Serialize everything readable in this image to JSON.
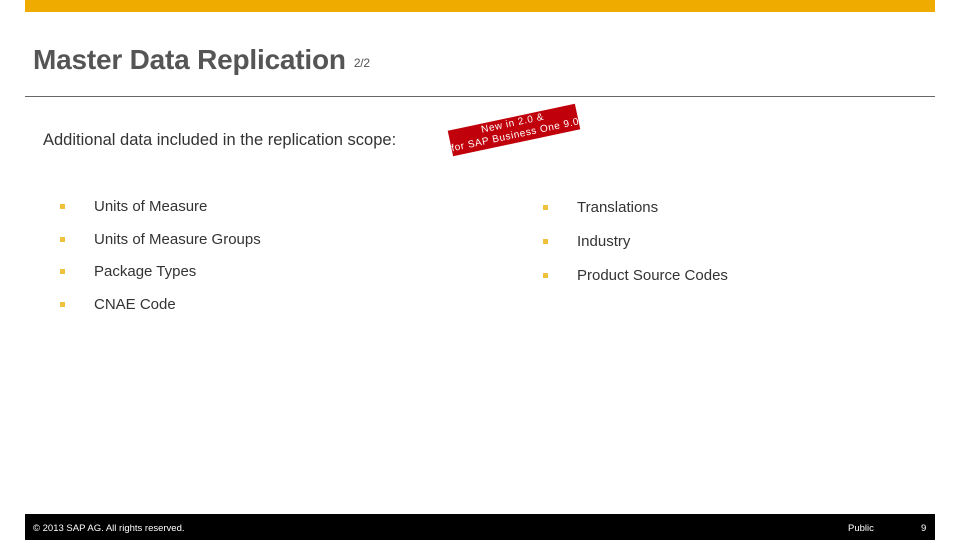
{
  "header": {
    "title": "Master Data Replication",
    "page_counter": "2/2"
  },
  "colors": {
    "accent_bar": "#f0ab00",
    "banner_red": "#c0000b",
    "bullet": "#f0c13c",
    "footer_bg": "#000000"
  },
  "subtitle": "Additional data included in the replication scope:",
  "banner": {
    "line1": "New in 2.0 &",
    "line2": "for SAP Business One 9.0"
  },
  "left_list": [
    {
      "label": "Units of Measure"
    },
    {
      "label": "Units of Measure Groups"
    },
    {
      "label": "Package Types"
    },
    {
      "label": "CNAE Code"
    }
  ],
  "right_list": [
    {
      "label": "Translations"
    },
    {
      "label": "Industry"
    },
    {
      "label": "Product Source Codes"
    }
  ],
  "footer": {
    "copyright": "© 2013 SAP AG. All rights reserved.",
    "classification": "Public",
    "page_number": "9"
  }
}
